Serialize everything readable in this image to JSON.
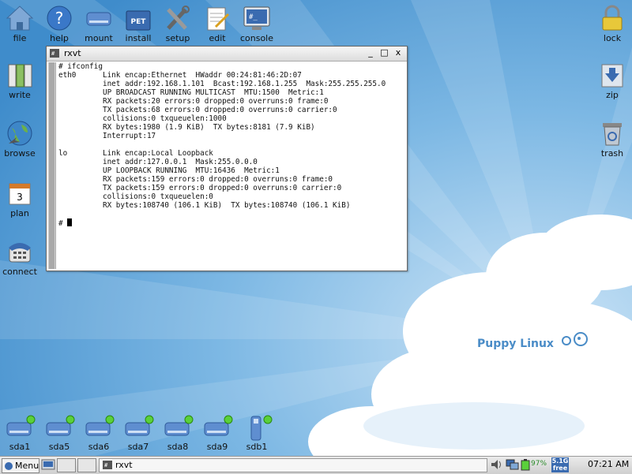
{
  "desktop_icons_left": [
    {
      "key": "file",
      "label": "file"
    },
    {
      "key": "help",
      "label": "help"
    },
    {
      "key": "mount",
      "label": "mount"
    },
    {
      "key": "install",
      "label": "install"
    },
    {
      "key": "setup",
      "label": "setup"
    },
    {
      "key": "edit",
      "label": "edit"
    },
    {
      "key": "console",
      "label": "console"
    }
  ],
  "desktop_icons_col": [
    {
      "key": "write",
      "label": "write"
    },
    {
      "key": "browse",
      "label": "browse"
    },
    {
      "key": "plan",
      "label": "plan"
    },
    {
      "key": "connect",
      "label": "connect"
    }
  ],
  "desktop_icons_right": [
    {
      "key": "lock",
      "label": "lock"
    },
    {
      "key": "zip",
      "label": "zip"
    },
    {
      "key": "trash",
      "label": "trash"
    }
  ],
  "install_badge": "PET",
  "plan_badge": "3",
  "drives": [
    "sda1",
    "sda5",
    "sda6",
    "sda7",
    "sda8",
    "sda9",
    "sdb1"
  ],
  "brand": "Puppy Linux",
  "terminal": {
    "title": "rxvt",
    "controls": {
      "menu": "_",
      "max": "□",
      "close": "x"
    },
    "lines": [
      "# ifconfig",
      "eth0      Link encap:Ethernet  HWaddr 00:24:81:46:2D:07",
      "          inet addr:192.168.1.101  Bcast:192.168.1.255  Mask:255.255.255.0",
      "          UP BROADCAST RUNNING MULTICAST  MTU:1500  Metric:1",
      "          RX packets:20 errors:0 dropped:0 overruns:0 frame:0",
      "          TX packets:68 errors:0 dropped:0 overruns:0 carrier:0",
      "          collisions:0 txqueuelen:1000",
      "          RX bytes:1980 (1.9 KiB)  TX bytes:8181 (7.9 KiB)",
      "          Interrupt:17",
      "",
      "lo        Link encap:Local Loopback",
      "          inet addr:127.0.0.1  Mask:255.0.0.0",
      "          UP LOOPBACK RUNNING  MTU:16436  Metric:1",
      "          RX packets:159 errors:0 dropped:0 overruns:0 frame:0",
      "          TX packets:159 errors:0 dropped:0 overruns:0 carrier:0",
      "          collisions:0 txqueuelen:0",
      "          RX bytes:108740 (106.1 KiB)  TX bytes:108740 (106.1 KiB)",
      ""
    ],
    "prompt": "# "
  },
  "taskbar": {
    "menu_label": "Menu",
    "task_label": "rxvt",
    "battery": "97%",
    "free_size": "5.1G",
    "free_label": "free",
    "clock": "07:21 AM"
  },
  "colors": {
    "sky": "#5a9fd4",
    "cloud": "#ffffff",
    "accent": "#3a6bb0"
  }
}
